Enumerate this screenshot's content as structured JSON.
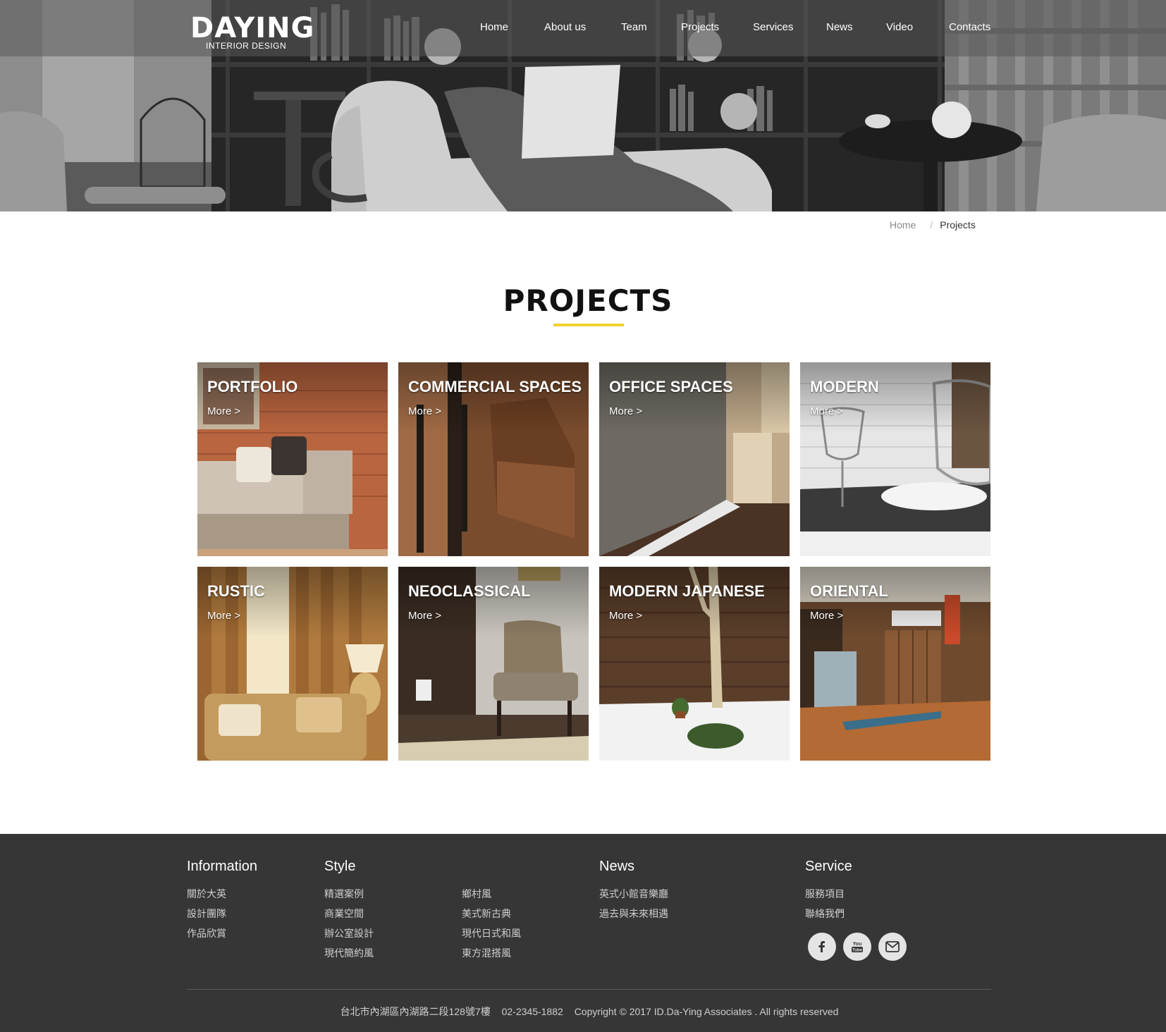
{
  "brand": {
    "name": "DAYING",
    "tagline": "INTERIOR DESIGN"
  },
  "nav": [
    {
      "label": "Home"
    },
    {
      "label": "About us"
    },
    {
      "label": "Team"
    },
    {
      "label": "Projects"
    },
    {
      "label": "Services"
    },
    {
      "label": "News"
    },
    {
      "label": "Video"
    },
    {
      "label": "Contacts"
    }
  ],
  "breadcrumb": {
    "home": "Home",
    "separator": "/",
    "current": "Projects"
  },
  "page_title": "PROJECTS",
  "accent_color": "#f0d230",
  "projects": [
    {
      "title": "PORTFOLIO",
      "more": "More >"
    },
    {
      "title": "COMMERCIAL SPACES",
      "more": "More >"
    },
    {
      "title": "OFFICE SPACES",
      "more": "More >"
    },
    {
      "title": "MODERN",
      "more": "More >"
    },
    {
      "title": "RUSTIC",
      "more": "More >"
    },
    {
      "title": "NEOCLASSICAL",
      "more": "More >"
    },
    {
      "title": "MODERN JAPANESE",
      "more": "More >"
    },
    {
      "title": "ORIENTAL",
      "more": "More >"
    }
  ],
  "footer": {
    "information": {
      "title": "Information",
      "links": [
        "關於大英",
        "設計團隊",
        "作品欣賞"
      ]
    },
    "style": {
      "title": "Style",
      "col1": [
        "精選案例",
        "商業空間",
        "辦公室設計",
        "現代簡約風"
      ],
      "col2": [
        "鄉村風",
        "美式新古典",
        "現代日式和風",
        "東方混搭風"
      ]
    },
    "news": {
      "title": "News",
      "links": [
        "英式小館音樂廳",
        "過去與未來相遇"
      ]
    },
    "service": {
      "title": "Service",
      "links": [
        "服務項目",
        "聯絡我們"
      ],
      "social": [
        "facebook-icon",
        "youtube-icon",
        "mail-icon"
      ]
    },
    "address": "台北市內湖區內湖路二段128號7樓",
    "phone": "02-2345-1882",
    "copyright": "Copyright © 2017 ID.Da-Ying Associates . All rights reserved"
  }
}
